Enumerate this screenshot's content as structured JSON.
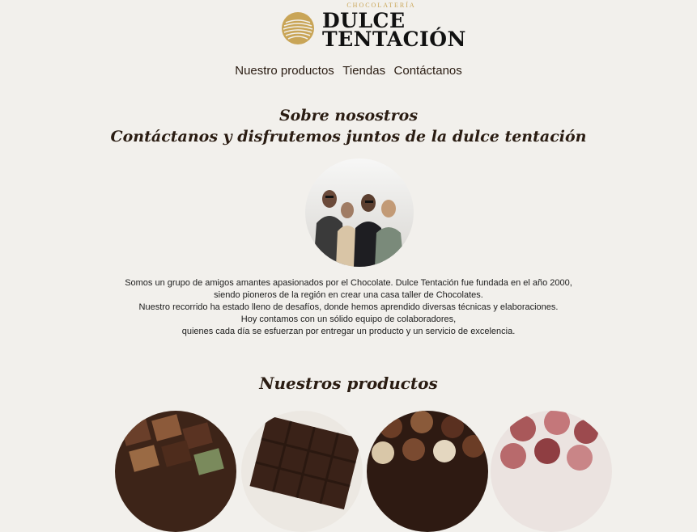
{
  "brand": {
    "small": "CHOCOLATERÍA",
    "line1": "DULCE",
    "line2": "TENTACIÓN",
    "gold": "#c9a557"
  },
  "nav": [
    {
      "label": "Nuestro productos"
    },
    {
      "label": "Tiendas"
    },
    {
      "label": "Contáctanos"
    }
  ],
  "about": {
    "title": "Sobre nosostros",
    "subtitle": "Contáctanos y disfrutemos juntos de la dulce tentación",
    "paragraph": [
      "Somos un grupo de amigos amantes apasionados por el Chocolate. Dulce Tentación fue fundada en el año 2000,",
      "siendo pioneros de la región en crear una casa taller de Chocolates.",
      "Nuestro recorrido ha estado lleno de desafíos, donde hemos aprendido diversas técnicas y elaboraciones.",
      "Hoy contamos con un sólido equipo de colaboradores,",
      "quienes cada día se esfuerzan por entregar un producto y un servicio de excelencia."
    ]
  },
  "products": {
    "title": "Nuestros productos"
  },
  "colors": {
    "background": "#f2f0ec",
    "text": "#2a1c12"
  }
}
